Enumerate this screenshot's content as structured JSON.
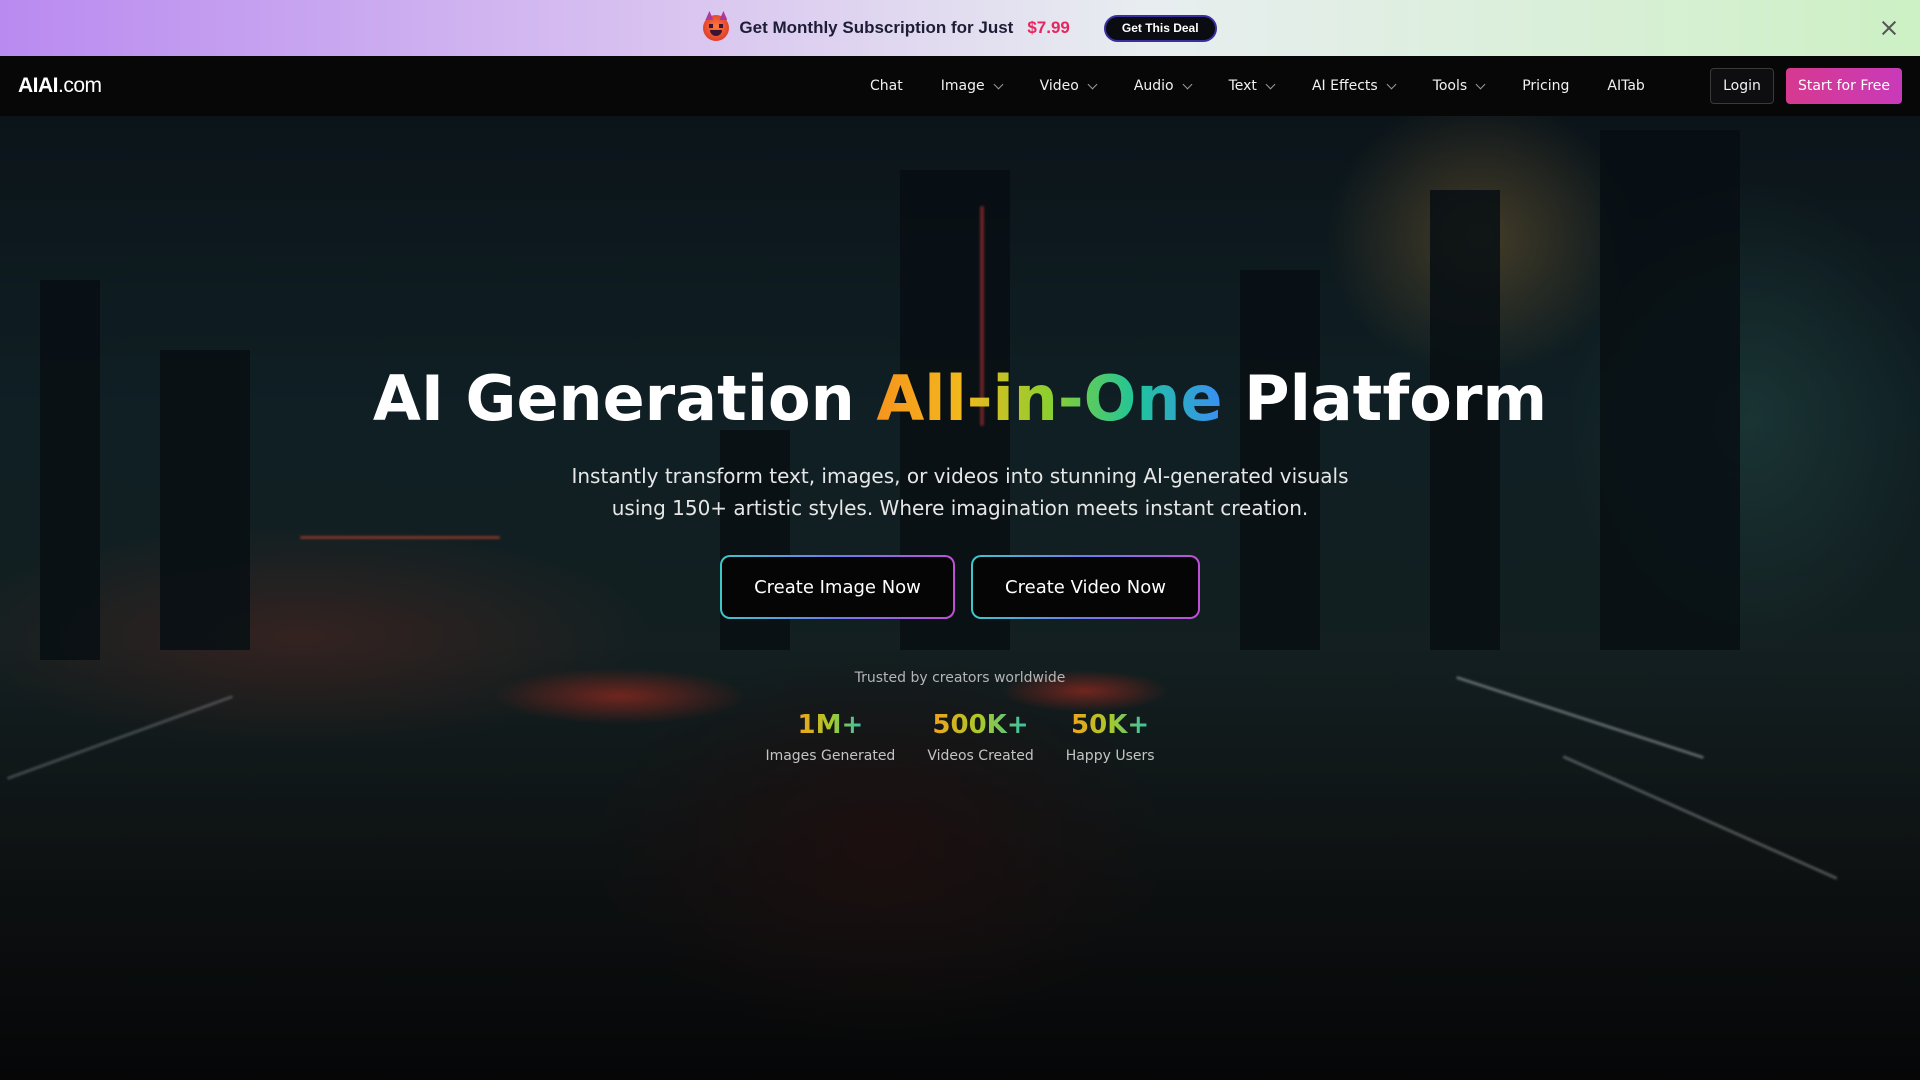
{
  "promo": {
    "text": "Get Monthly Subscription for Just",
    "price": "$7.99",
    "deal_button": "Get This Deal"
  },
  "nav": {
    "logo_bold": "AIAI",
    "logo_rest": ".com",
    "items": [
      {
        "label": "Chat",
        "dropdown": false
      },
      {
        "label": "Image",
        "dropdown": true
      },
      {
        "label": "Video",
        "dropdown": true
      },
      {
        "label": "Audio",
        "dropdown": true
      },
      {
        "label": "Text",
        "dropdown": true
      },
      {
        "label": "AI Effects",
        "dropdown": true
      },
      {
        "label": "Tools",
        "dropdown": true
      },
      {
        "label": "Pricing",
        "dropdown": false
      },
      {
        "label": "AITab",
        "dropdown": false
      }
    ],
    "login": "Login",
    "start": "Start for Free"
  },
  "hero": {
    "title_prefix": "AI Generation ",
    "title_highlight": "All-in-One",
    "title_suffix": " Platform",
    "subtitle_line1": "Instantly transform text, images, or videos into stunning AI-generated visuals",
    "subtitle_line2": "using 150+ artistic styles. Where imagination meets instant creation.",
    "cta_image": "Create Image Now",
    "cta_video": "Create Video Now",
    "trusted": "Trusted by creators worldwide",
    "stats": [
      {
        "value": "1M+",
        "label": "Images Generated"
      },
      {
        "value": "500K+",
        "label": "Videos Created"
      },
      {
        "value": "50K+",
        "label": "Happy Users"
      }
    ]
  },
  "colors": {
    "accent_pink": "#d6398f",
    "price_red": "#e8245f",
    "gradient_start": "#f7941d",
    "gradient_end": "#3b8ef5"
  }
}
